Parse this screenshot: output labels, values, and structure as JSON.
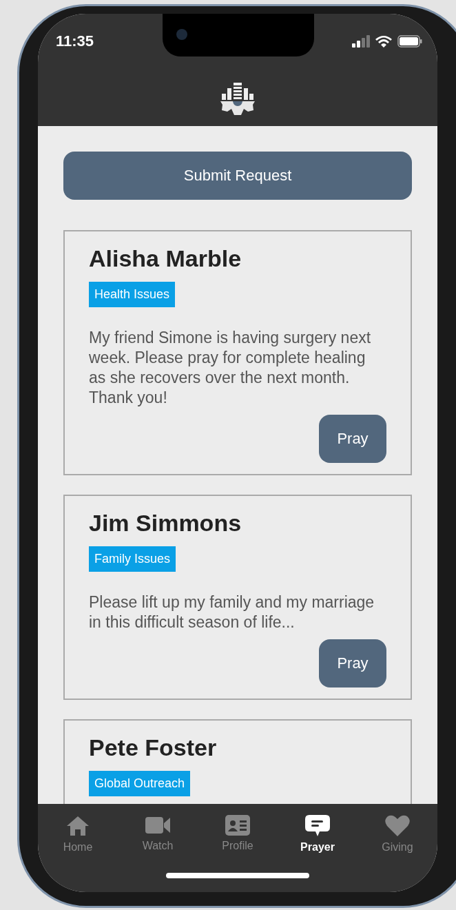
{
  "status_bar": {
    "time": "11:35"
  },
  "submit_button": {
    "label": "Submit Request"
  },
  "requests": [
    {
      "name": "Alisha Marble",
      "tag": "Health Issues",
      "message": "My friend Simone is having surgery next week. Please pray for complete healing as she recovers over the next month. Thank you!",
      "button": "Pray"
    },
    {
      "name": "Jim Simmons",
      "tag": "Family Issues",
      "message": "Please lift up my family and my marriage in this difficult season of life...",
      "button": "Pray"
    },
    {
      "name": "Pete Foster",
      "tag": "Global Outreach"
    }
  ],
  "tabs": [
    {
      "label": "Home",
      "selected": false
    },
    {
      "label": "Watch",
      "selected": false
    },
    {
      "label": "Profile",
      "selected": false
    },
    {
      "label": "Prayer",
      "selected": true
    },
    {
      "label": "Giving",
      "selected": false
    }
  ]
}
